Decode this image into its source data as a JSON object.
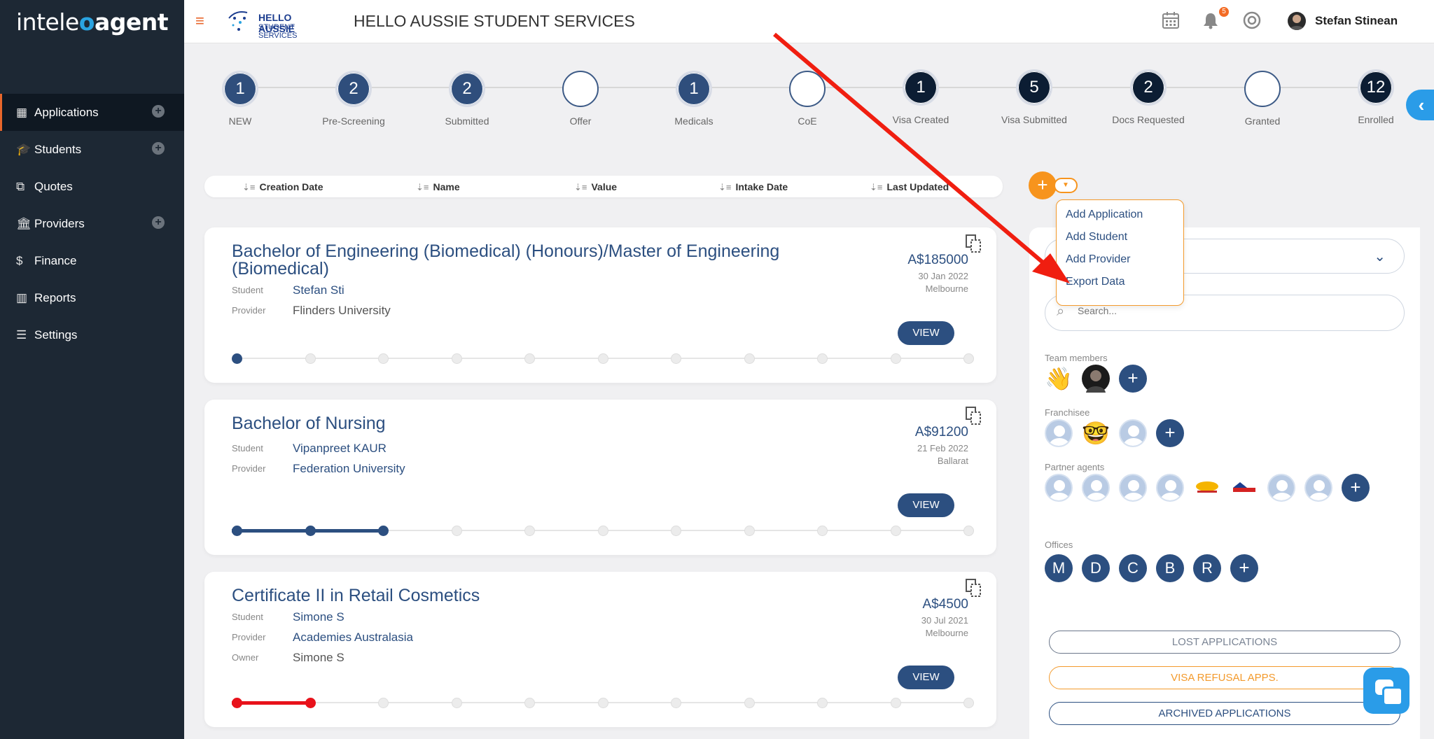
{
  "app": {
    "logo_pre": "intele",
    "logo_mid": "o",
    "logo_post": "agent"
  },
  "sidebar": {
    "items": [
      {
        "label": "Applications",
        "icon": "grid-icon",
        "active": true,
        "has_add": true
      },
      {
        "label": "Students",
        "icon": "graduation-cap-icon",
        "has_add": true
      },
      {
        "label": "Quotes",
        "icon": "documents-icon",
        "has_add": false
      },
      {
        "label": "Providers",
        "icon": "institution-icon",
        "has_add": true
      },
      {
        "label": "Finance",
        "icon": "dollar-icon",
        "has_add": false
      },
      {
        "label": "Reports",
        "icon": "bar-chart-icon",
        "has_add": false
      },
      {
        "label": "Settings",
        "icon": "sliders-icon",
        "has_add": false
      }
    ]
  },
  "header": {
    "brand_line1": "HELLO AUSSIE",
    "brand_line2": "STUDENT SERVICES",
    "company": "HELLO AUSSIE STUDENT SERVICES",
    "notification_count": "5",
    "user_name": "Stefan Stinean"
  },
  "stages": [
    {
      "count": "1",
      "label": "NEW"
    },
    {
      "count": "2",
      "label": "Pre-Screening"
    },
    {
      "count": "2",
      "label": "Submitted"
    },
    {
      "count": "",
      "label": "Offer"
    },
    {
      "count": "1",
      "label": "Medicals"
    },
    {
      "count": "",
      "label": "CoE"
    },
    {
      "count": "1",
      "label": "Visa Created"
    },
    {
      "count": "5",
      "label": "Visa Submitted"
    },
    {
      "count": "2",
      "label": "Docs Requested"
    },
    {
      "count": "",
      "label": "Granted"
    },
    {
      "count": "12",
      "label": "Enrolled"
    }
  ],
  "sort": [
    "Creation Date",
    "Name",
    "Value",
    "Intake Date",
    "Last Updated"
  ],
  "labels": {
    "student": "Student",
    "provider": "Provider",
    "owner": "Owner",
    "view": "VIEW"
  },
  "cards": [
    {
      "title": "Bachelor of Engineering (Biomedical) (Honours)/Master of Engineering (Biomedical)",
      "student": "Stefan Sti",
      "provider": "Flinders University",
      "price": "A$185000",
      "date": "30 Jan 2022",
      "city": "Melbourne",
      "progress_steps": 1,
      "progress_color": "#2c4f80"
    },
    {
      "title": "Bachelor of Nursing",
      "student": "Vipanpreet KAUR",
      "provider": "Federation University",
      "price": "A$91200",
      "date": "21 Feb 2022",
      "city": "Ballarat",
      "progress_steps": 3,
      "progress_color": "#2c4f80"
    },
    {
      "title": "Certificate II in Retail Cosmetics",
      "student": "Simone S",
      "provider": "Academies Australasia",
      "owner": "Simone S",
      "price": "A$4500",
      "date": "30 Jul 2021",
      "city": "Melbourne",
      "progress_steps": 2,
      "progress_color": "#e8121b"
    }
  ],
  "add_menu": [
    "Add Application",
    "Add Student",
    "Add Provider",
    "Export Data"
  ],
  "right_panel": {
    "search_placeholder": "Search...",
    "team_members_label": "Team members",
    "franchisee_label": "Franchisee",
    "partner_agents_label": "Partner agents",
    "offices_label": "Offices",
    "offices": [
      "M",
      "D",
      "C",
      "B",
      "R"
    ],
    "lost_btn": "LOST APPLICATIONS",
    "refusal_btn": "VISA REFUSAL APPS.",
    "archived_btn": "ARCHIVED APPLICATIONS"
  },
  "colors": {
    "accent": "#e8662b",
    "navy": "#2c4f80",
    "orange": "#f7941d",
    "arrow": "#f01e10"
  }
}
